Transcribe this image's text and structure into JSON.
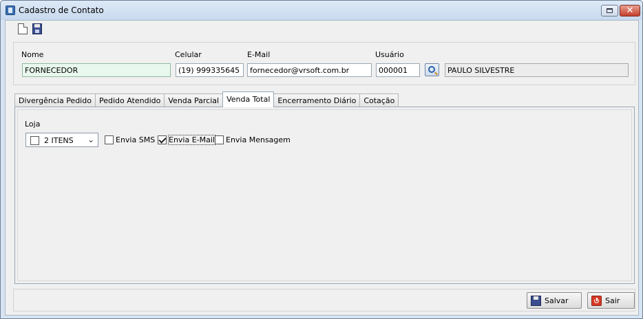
{
  "window": {
    "title": "Cadastro de Contato"
  },
  "form": {
    "nome": {
      "label": "Nome",
      "value": "FORNECEDOR"
    },
    "celular": {
      "label": "Celular",
      "value": "(19) 999335645"
    },
    "email": {
      "label": "E-Mail",
      "value": "fornecedor@vrsoft.com.br"
    },
    "usuario": {
      "label": "Usuário",
      "code": "000001",
      "name": "PAULO SILVESTRE"
    }
  },
  "tabs": [
    {
      "label": "Divergência Pedido"
    },
    {
      "label": "Pedido Atendido"
    },
    {
      "label": "Venda Parcial"
    },
    {
      "label": "Venda Total",
      "active": true
    },
    {
      "label": "Encerramento Diário"
    },
    {
      "label": "Cotação"
    }
  ],
  "venda_total": {
    "loja_label": "Loja",
    "loja_value": "2 ITENS",
    "options": [
      {
        "label": "Envia SMS",
        "checked": false
      },
      {
        "label": "Envia E-Mail",
        "checked": true
      },
      {
        "label": "Envia Mensagem",
        "checked": false
      }
    ]
  },
  "buttons": {
    "save": "Salvar",
    "exit": "Sair"
  },
  "icons": {
    "app": "contact-form-icon",
    "new": "new-document-icon",
    "save": "save-icon",
    "lookup": "search-icon",
    "exit": "power-icon"
  }
}
